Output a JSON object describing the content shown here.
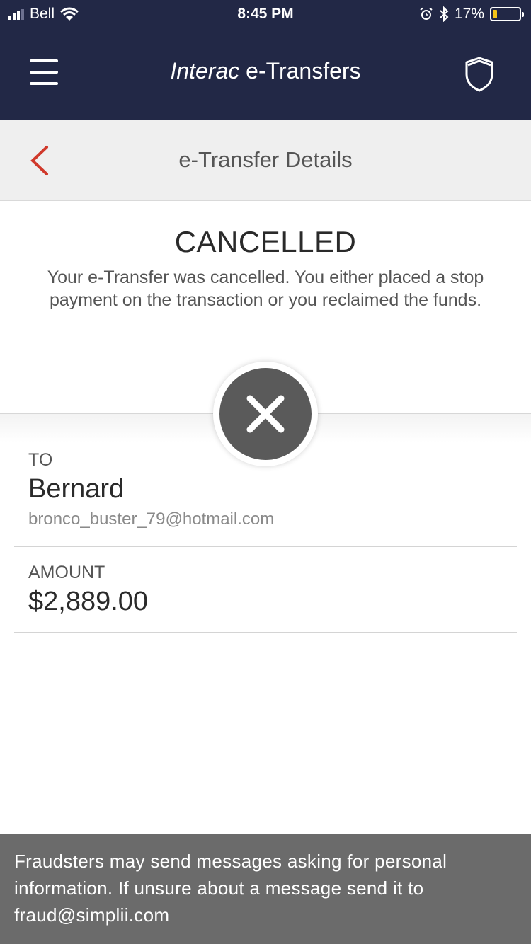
{
  "status_bar": {
    "carrier": "Bell",
    "time": "8:45 PM",
    "battery": "17%",
    "battery_level": 0.17,
    "icons": [
      "signal-icon",
      "wifi-icon",
      "alarm-icon",
      "bluetooth-icon",
      "battery-icon"
    ]
  },
  "app_header": {
    "title_brand": "Interac",
    "title_rest": " e-Transfers",
    "menu_icon": "hamburger-menu-icon",
    "security_icon": "shield-icon"
  },
  "sub_header": {
    "title": "e-Transfer Details",
    "back_icon": "chevron-left-icon"
  },
  "transfer_status": {
    "title": "CANCELLED",
    "description": "Your e-Transfer was cancelled. You either placed a stop payment on the transaction or you reclaimed the funds.",
    "status_icon": "cancel-x-icon"
  },
  "details": {
    "to_label": "TO",
    "recipient_name": "Bernard",
    "recipient_email": "bronco_buster_79@hotmail.com",
    "amount_label": "AMOUNT",
    "amount_value": "$2,889.00"
  },
  "footer": {
    "message": "Fraudsters may send messages asking for personal information. If unsure about a message send it to fraud@simplii.com"
  },
  "colors": {
    "header_bg": "#222846",
    "subheader_bg": "#efefef",
    "back_accent": "#d0392b",
    "status_circle": "#5a5a5a",
    "footer_bg": "#6b6b6b",
    "battery_fill": "#f5c518"
  }
}
